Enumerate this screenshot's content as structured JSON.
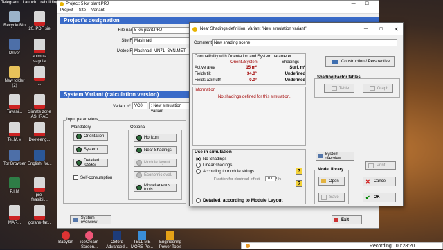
{
  "desktop": {
    "top_labels": [
      "Telegram",
      "Launch",
      "rebuildings"
    ],
    "icons": [
      {
        "label": "Recycle Bin",
        "icon": "recycle-bin-icon",
        "color": "bin"
      },
      {
        "label": "20..PDF sie",
        "icon": "pdf-file-icon",
        "color": "pdf"
      },
      {
        "label": "Driver",
        "icon": "app-icon",
        "color": "app"
      },
      {
        "label": "animula vagula",
        "icon": "pdf-file-icon",
        "color": "pdf"
      },
      {
        "label": "New folder (2)",
        "icon": "folder-icon",
        "color": "fold"
      },
      {
        "label": "...",
        "icon": "pdf-file-icon",
        "color": "pdf"
      },
      {
        "label": "Tavani...",
        "icon": "pdf-file-icon",
        "color": "pdf"
      },
      {
        "label": "climate zone ASHRAE",
        "icon": "pdf-file-icon",
        "color": "pdf"
      },
      {
        "label": "Tel.M.M",
        "icon": "pdf-file-icon",
        "color": "pdf"
      },
      {
        "label": "Deeteeng...",
        "icon": "pdf-file-icon",
        "color": "pdf"
      },
      {
        "label": "Tor Browser",
        "icon": "app-icon",
        "color": "app"
      },
      {
        "label": "English_for...",
        "icon": "word-file-icon",
        "color": "wd"
      },
      {
        "label": "P.I.M",
        "icon": "excel-file-icon",
        "color": "xl"
      },
      {
        "label": "pre-feasibil...",
        "icon": "pdf-file-icon",
        "color": "pdf"
      },
      {
        "label": "MAR...",
        "icon": "pdf-file-icon",
        "color": "pdf"
      },
      {
        "label": "gorane-far...",
        "icon": "pdf-file-icon",
        "color": "pdf"
      }
    ],
    "taskbar": [
      "Babylon",
      "iceCream Screen...",
      "Oxford Advanced...",
      "TELL ME MORE Pe...",
      "Engineering Power Tools"
    ],
    "recording_label": "Recording:",
    "recording_time": "00:28:20"
  },
  "main": {
    "window_title": "Project: 5 kw plant.PRJ",
    "menu": [
      "Project",
      "Site",
      "Variant"
    ],
    "designation_header": "Project's designation",
    "file_name_label": "File name",
    "file_name": "5 kw plant.PRJ",
    "site_file_label": "Site File",
    "site_file": "Mashhad",
    "meteo_file_label": "Meteo File",
    "meteo_file": "Mashhad_MN71_SYN.MET",
    "variant_header": "System Variant (calculation version)",
    "variant_label": "Variant n°",
    "variant_code": "VC0",
    "variant_name": ": New simulation variant",
    "input_params_title": "Input parameters",
    "mandatory_title": "Mandatory",
    "optional_title": "Optional",
    "mandatory_buttons": [
      "Orientation",
      "System",
      "Detailed losses"
    ],
    "self_consumption": "Self-consumption",
    "optional_buttons": [
      "Horizon",
      "Near Shadings",
      "Module layout",
      "Economic eval.",
      "Miscellaneous tools"
    ],
    "system_overview": "System overview",
    "exit": "Exit"
  },
  "dialog": {
    "title": "Near Shadings definition, Variant \"New simulation variant\"",
    "comment_label": "Comment",
    "comment_value": "New shading scene",
    "compat_title": "Compatibility with Orientation and System parameter",
    "col_orient": "Orient./System",
    "col_shadings": "Shadings",
    "rows": [
      {
        "label": "Active area",
        "orient": "15 m²",
        "shadings": "Surf. m²"
      },
      {
        "label": "Fields tilt",
        "orient": "34.0°",
        "shadings": "Undefined"
      },
      {
        "label": "Fields azimuth",
        "orient": "0.0°",
        "shadings": "Undefined"
      }
    ],
    "info_title": "Information",
    "info_text": "No shadings defined for this simulation.",
    "construction_btn": "Construction / Perspective",
    "shading_factor_title": "Shading Factor tables",
    "table_btn": "Table",
    "graph_btn": "Graph",
    "use_in_sim_title": "Use in simulation",
    "options": [
      "No Shadings",
      "Linear shadings",
      "According to module strings"
    ],
    "fraction_label": "Fraction for electrical effect",
    "fraction_value": "100.0",
    "fraction_unit": "%",
    "detailed_label": "Detailed, according to Module Layout",
    "system_overview": "System overview",
    "print": "Print",
    "model_library_title": "Model library",
    "open": "Open",
    "save": "Save",
    "cancel": "Cancel",
    "ok": "OK"
  }
}
